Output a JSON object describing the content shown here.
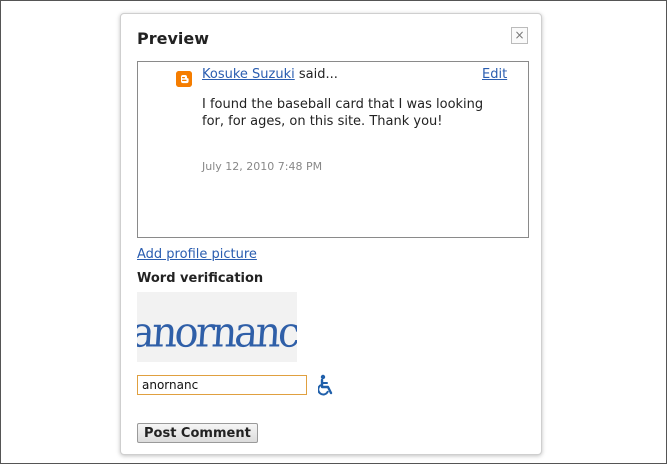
{
  "dialog": {
    "title": "Preview",
    "close_icon": "×"
  },
  "comment": {
    "author": "Kosuke Suzuki",
    "said": " said...",
    "edit_label": "Edit",
    "text": "I found the baseball card that I was looking for, for ages, on this site. Thank you!",
    "timestamp": "July 12, 2010 7:48 PM",
    "author_icon": "blogger-icon"
  },
  "profile": {
    "add_picture_label": "Add profile picture"
  },
  "verification": {
    "label": "Word verification",
    "captcha_word": "anornanc",
    "input_value": "anornanc",
    "accessibility_icon": "wheelchair-icon"
  },
  "actions": {
    "post_label": "Post Comment"
  },
  "colors": {
    "link": "#2a5db0",
    "blogger_orange": "#f57d00",
    "captcha_blue": "#2f5fa8",
    "input_border": "#e0a040"
  }
}
